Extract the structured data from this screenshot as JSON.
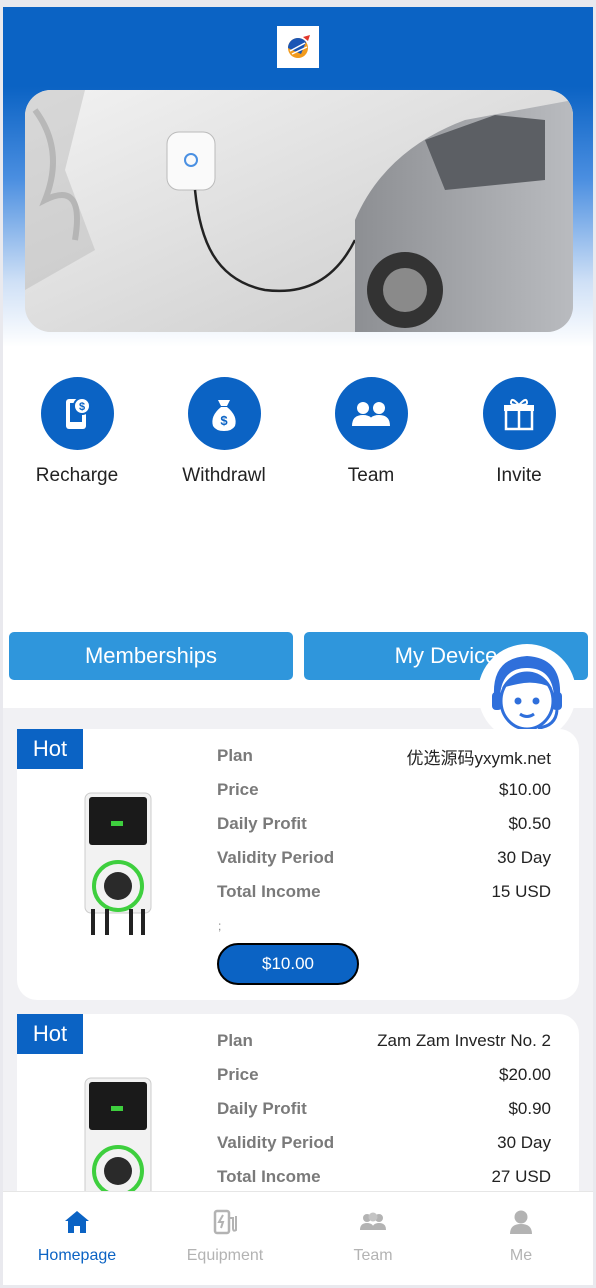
{
  "header": {
    "logo": "solar-globe-logo"
  },
  "banner": {
    "image": "ev-charger-car-photo"
  },
  "quick_actions": [
    {
      "label": "Recharge",
      "icon": "phone-dollar-icon"
    },
    {
      "label": "Withdrawl",
      "icon": "money-bag-icon"
    },
    {
      "label": "Team",
      "icon": "team-icon"
    },
    {
      "label": "Invite",
      "icon": "gift-icon"
    }
  ],
  "tabs": {
    "memberships": "Memberships",
    "my_device": "My Device"
  },
  "customer_service": {
    "icon": "customer-service-icon"
  },
  "plans": [
    {
      "badge": "Hot",
      "plan_key": "Plan",
      "plan": "优选源码yxymk.net",
      "price_key": "Price",
      "price": "$10.00",
      "profit_key": "Daily Profit",
      "profit": "$0.50",
      "validity_key": "Validity Period",
      "validity": "30 Day",
      "income_key": "Total Income",
      "income": "15 USD",
      "note": ";",
      "button": "$10.00"
    },
    {
      "badge": "Hot",
      "plan_key": "Plan",
      "plan": "Zam Zam Investr No. 2",
      "price_key": "Price",
      "price": "$20.00",
      "profit_key": "Daily Profit",
      "profit": "$0.90",
      "validity_key": "Validity Period",
      "validity": "30 Day",
      "income_key": "Total Income",
      "income": "27 USD"
    }
  ],
  "bottom_nav": [
    {
      "label": "Homepage",
      "icon": "home-icon",
      "active": true
    },
    {
      "label": "Equipment",
      "icon": "charging-station-icon",
      "active": false
    },
    {
      "label": "Team",
      "icon": "team-icon",
      "active": false
    },
    {
      "label": "Me",
      "icon": "user-icon",
      "active": false
    }
  ],
  "colors": {
    "primary": "#0b63c4",
    "tab": "#2f96dc",
    "inactive": "#b3b3b3"
  }
}
